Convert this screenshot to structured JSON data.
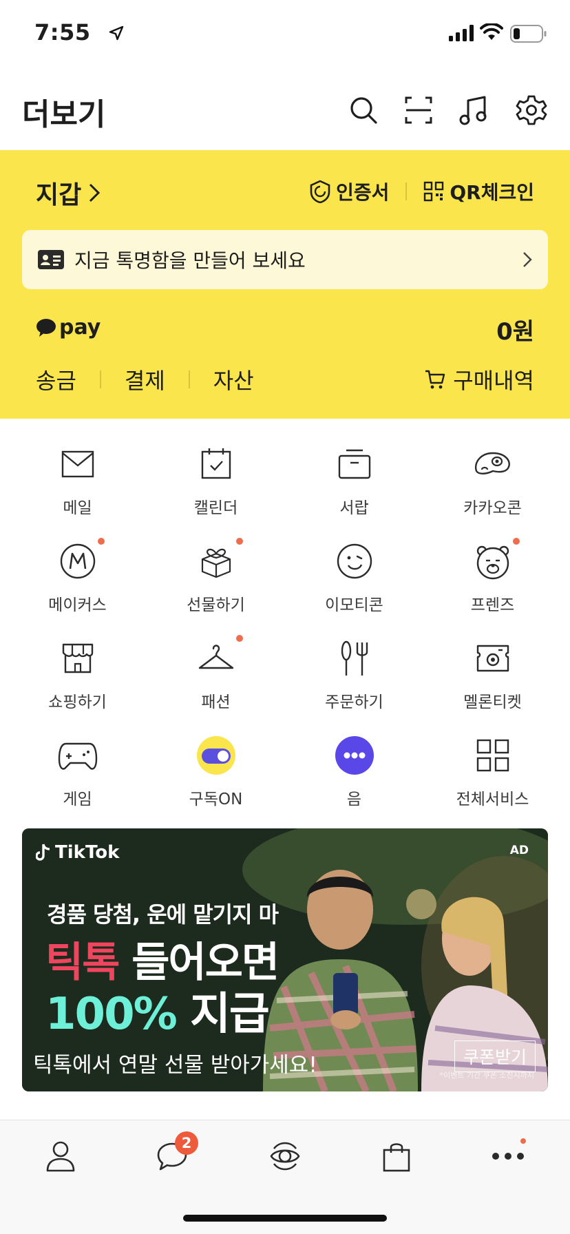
{
  "status_bar": {
    "time": "7:55"
  },
  "header": {
    "title": "더보기"
  },
  "wallet": {
    "title": "지갑",
    "links": {
      "certificate": "인증서",
      "qr_checkin": "QR체크인"
    },
    "promo_text": "지금 톡명함을 만들어 보세요",
    "pay": {
      "logo": "pay",
      "balance": "0원",
      "tabs": [
        "송금",
        "결제",
        "자산"
      ],
      "purchase_history": "구매내역"
    }
  },
  "services": [
    {
      "label": "메일",
      "icon": "mail-icon"
    },
    {
      "label": "캘린더",
      "icon": "calendar-icon"
    },
    {
      "label": "서랍",
      "icon": "drawer-icon"
    },
    {
      "label": "카카오콘",
      "icon": "kakaocon-icon"
    },
    {
      "label": "메이커스",
      "icon": "makers-icon"
    },
    {
      "label": "선물하기",
      "icon": "gift-icon"
    },
    {
      "label": "이모티콘",
      "icon": "emoticon-icon"
    },
    {
      "label": "프렌즈",
      "icon": "friends-icon"
    },
    {
      "label": "쇼핑하기",
      "icon": "shop-icon"
    },
    {
      "label": "패션",
      "icon": "hanger-icon"
    },
    {
      "label": "주문하기",
      "icon": "fork-icon"
    },
    {
      "label": "멜론티켓",
      "icon": "ticket-icon"
    },
    {
      "label": "게임",
      "icon": "gamepad-icon"
    },
    {
      "label": "구독ON",
      "icon": "toggle-icon"
    },
    {
      "label": "음",
      "icon": "voice-icon"
    },
    {
      "label": "전체서비스",
      "icon": "grid-icon"
    }
  ],
  "ad": {
    "brand": "TikTok",
    "badge": "AD",
    "line1": "경품 당첨, 운에 맡기지 마",
    "line2_pink": "틱톡",
    "line2_white": "들어오면",
    "line3_num": "100%",
    "line3_white": "지급",
    "bottom_text": "틱톡에서 연말 선물 받아가세요!",
    "button": "쿠폰받기",
    "fine_print": "*이벤트 기간 쿠폰 소진시까지"
  },
  "tabbar": {
    "chat_badge": "2"
  },
  "colors": {
    "wallet_bg": "#fae54d",
    "promo_bg": "#fdf8d7",
    "notification_dot": "#ee6d4d",
    "badge": "#ee5a3c"
  }
}
